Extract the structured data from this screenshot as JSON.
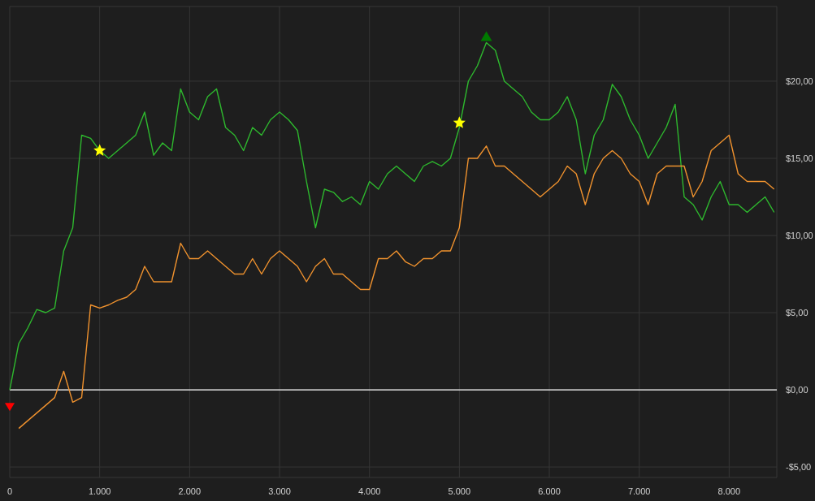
{
  "chart_data": {
    "type": "line",
    "grid": true,
    "xlim": [
      0,
      8530
    ],
    "ylim": [
      -5.68,
      24.84
    ],
    "x": [
      0,
      100,
      200,
      300,
      400,
      500,
      600,
      700,
      800,
      900,
      1000,
      1100,
      1200,
      1300,
      1400,
      1500,
      1600,
      1700,
      1800,
      1900,
      2000,
      2100,
      2200,
      2300,
      2400,
      2500,
      2600,
      2700,
      2800,
      2900,
      3000,
      3100,
      3200,
      3300,
      3400,
      3500,
      3600,
      3700,
      3800,
      3900,
      4000,
      4100,
      4200,
      4300,
      4400,
      4500,
      4600,
      4700,
      4800,
      4900,
      5000,
      5100,
      5200,
      5300,
      5400,
      5500,
      5600,
      5700,
      5800,
      5900,
      6000,
      6100,
      6200,
      6300,
      6400,
      6500,
      6600,
      6700,
      6800,
      6900,
      7000,
      7100,
      7200,
      7300,
      7400,
      7500,
      7600,
      7700,
      7800,
      7900,
      8000,
      8100,
      8200,
      8300,
      8400,
      8500
    ],
    "xticks": [
      {
        "value": 0,
        "label": "0"
      },
      {
        "value": 1000,
        "label": "1.000"
      },
      {
        "value": 2000,
        "label": "2.000"
      },
      {
        "value": 3000,
        "label": "3.000"
      },
      {
        "value": 4000,
        "label": "4.000"
      },
      {
        "value": 5000,
        "label": "5.000"
      },
      {
        "value": 6000,
        "label": "6.000"
      },
      {
        "value": 7000,
        "label": "7.000"
      },
      {
        "value": 8000,
        "label": "8.000"
      }
    ],
    "yticks": [
      {
        "value": -5,
        "label": "-$5,00"
      },
      {
        "value": 0,
        "label": "$0,00"
      },
      {
        "value": 5,
        "label": "$5,00"
      },
      {
        "value": 10,
        "label": "$10,00"
      },
      {
        "value": 15,
        "label": "$15,00"
      },
      {
        "value": 20,
        "label": "$20,00"
      }
    ],
    "ref_lines": [
      {
        "axis": "y",
        "value": 0,
        "color": "#ffffff"
      }
    ],
    "series": [
      {
        "type": "line",
        "color": "#2eb82e",
        "values": [
          0,
          3,
          4,
          5.2,
          5,
          5.3,
          9,
          10.5,
          16.5,
          16.3,
          15.5,
          15,
          15.5,
          16,
          16.5,
          18,
          15.2,
          16,
          15.5,
          19.5,
          18,
          17.5,
          19,
          19.5,
          17,
          16.5,
          15.5,
          17,
          16.5,
          17.5,
          18,
          17.5,
          16.8,
          13.5,
          10.5,
          13,
          12.8,
          12.2,
          12.5,
          12,
          13.5,
          13,
          14,
          14.5,
          14,
          13.5,
          14.5,
          14.8,
          14.5,
          15,
          17,
          20,
          21,
          22.5,
          22,
          20,
          19.5,
          19,
          18,
          17.5,
          17.5,
          18,
          19,
          17.5,
          14,
          16.5,
          17.5,
          19.8,
          19,
          17.5,
          16.5,
          15,
          16,
          17,
          18.5,
          12.5,
          12,
          11,
          12.5,
          13.5,
          12,
          12,
          11.5,
          12,
          12.5,
          11.5
        ]
      },
      {
        "type": "line",
        "color": "#f0922e",
        "values": [
          null,
          -2.5,
          -2,
          -1.5,
          -1,
          -0.5,
          1.2,
          -0.8,
          -0.5,
          5.5,
          5.3,
          5.5,
          5.8,
          6,
          6.5,
          8,
          7,
          7,
          7,
          9.5,
          8.5,
          8.5,
          9,
          8.5,
          8,
          7.5,
          7.5,
          8.5,
          7.5,
          8.5,
          9,
          8.5,
          8,
          7,
          8,
          8.5,
          7.5,
          7.5,
          7,
          6.5,
          6.5,
          8.5,
          8.5,
          9,
          8.3,
          8,
          8.5,
          8.5,
          9,
          9,
          10.5,
          15,
          15,
          15.8,
          14.5,
          14.5,
          14,
          13.5,
          13,
          12.5,
          13,
          13.5,
          14.5,
          14,
          12,
          14,
          15,
          15.5,
          15,
          14,
          13.5,
          12,
          14,
          14.5,
          14.5,
          14.5,
          12.5,
          13.5,
          15.5,
          16,
          16.5,
          14,
          13.5,
          13.5,
          13.5,
          13
        ]
      },
      {
        "type": "scatter",
        "marker": "star",
        "color": "#ffff00",
        "values": [
          null,
          null,
          null,
          null,
          null,
          null,
          null,
          null,
          null,
          null,
          15.5,
          null,
          null,
          null,
          null,
          null,
          null,
          null,
          null,
          null,
          null,
          null,
          null,
          null,
          null,
          null,
          null,
          null,
          null,
          null,
          null,
          null,
          null,
          null,
          null,
          null,
          null,
          null,
          null,
          null,
          null,
          null,
          null,
          null,
          null,
          null,
          null,
          null,
          null,
          null,
          17.3,
          null,
          null,
          null,
          null,
          null,
          null,
          null,
          null,
          null,
          null,
          null,
          null,
          null,
          null,
          null,
          null,
          null,
          null,
          null,
          null,
          null,
          null,
          null,
          null,
          null,
          null,
          null,
          null,
          null,
          null,
          null,
          null,
          null,
          null,
          null
        ]
      },
      {
        "type": "scatter",
        "marker": "triangle-up",
        "color": "#007a00",
        "values": [
          null,
          null,
          null,
          null,
          null,
          null,
          null,
          null,
          null,
          null,
          null,
          null,
          null,
          null,
          null,
          null,
          null,
          null,
          null,
          null,
          null,
          null,
          null,
          null,
          null,
          null,
          null,
          null,
          null,
          null,
          null,
          null,
          null,
          null,
          null,
          null,
          null,
          null,
          null,
          null,
          null,
          null,
          null,
          null,
          null,
          null,
          null,
          null,
          null,
          null,
          null,
          null,
          null,
          22.9,
          null,
          null,
          null,
          null,
          null,
          null,
          null,
          null,
          null,
          null,
          null,
          null,
          null,
          null,
          null,
          null,
          null,
          null,
          null,
          null,
          null,
          null,
          null,
          null,
          null,
          null,
          null,
          null,
          null,
          null,
          null,
          null
        ]
      },
      {
        "type": "scatter",
        "marker": "triangle-down",
        "color": "#ff0000",
        "values": [
          -1.1,
          null,
          null,
          null,
          null,
          null,
          null,
          null,
          null,
          null,
          null,
          null,
          null,
          null,
          null,
          null,
          null,
          null,
          null,
          null,
          null,
          null,
          null,
          null,
          null,
          null,
          null,
          null,
          null,
          null,
          null,
          null,
          null,
          null,
          null,
          null,
          null,
          null,
          null,
          null,
          null,
          null,
          null,
          null,
          null,
          null,
          null,
          null,
          null,
          null,
          null,
          null,
          null,
          null,
          null,
          null,
          null,
          null,
          null,
          null,
          null,
          null,
          null,
          null,
          null,
          null,
          null,
          null,
          null,
          null,
          null,
          null,
          null,
          null,
          null,
          null,
          null,
          null,
          null,
          null,
          null,
          null,
          null,
          null,
          null,
          null
        ]
      }
    ]
  }
}
